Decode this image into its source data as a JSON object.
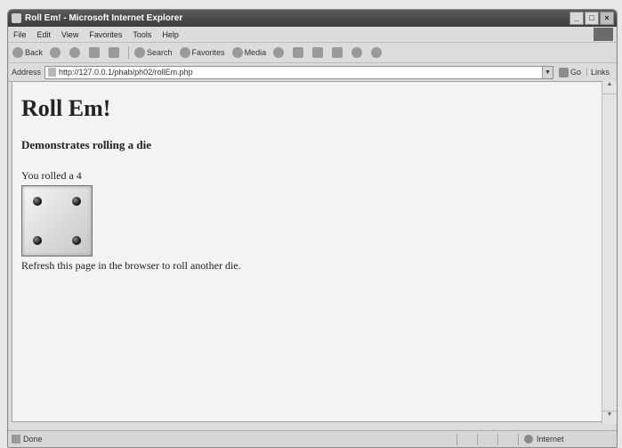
{
  "window": {
    "title": "Roll Em! - Microsoft Internet Explorer"
  },
  "menu": [
    "File",
    "Edit",
    "View",
    "Favorites",
    "Tools",
    "Help"
  ],
  "toolbar": {
    "back": "Back",
    "search": "Search",
    "favorites": "Favorites",
    "media": "Media"
  },
  "address": {
    "label": "Address",
    "url": "http://127.0.0.1/phab/ph02/rollEm.php",
    "go": "Go",
    "links": "Links"
  },
  "page": {
    "heading": "Roll Em!",
    "subheading": "Demonstrates rolling a die",
    "rolled_text": "You rolled a 4",
    "die_value": 4,
    "refresh_text": "Refresh this page in the browser to roll another die."
  },
  "status": {
    "text": "Done",
    "zone": "Internet"
  }
}
